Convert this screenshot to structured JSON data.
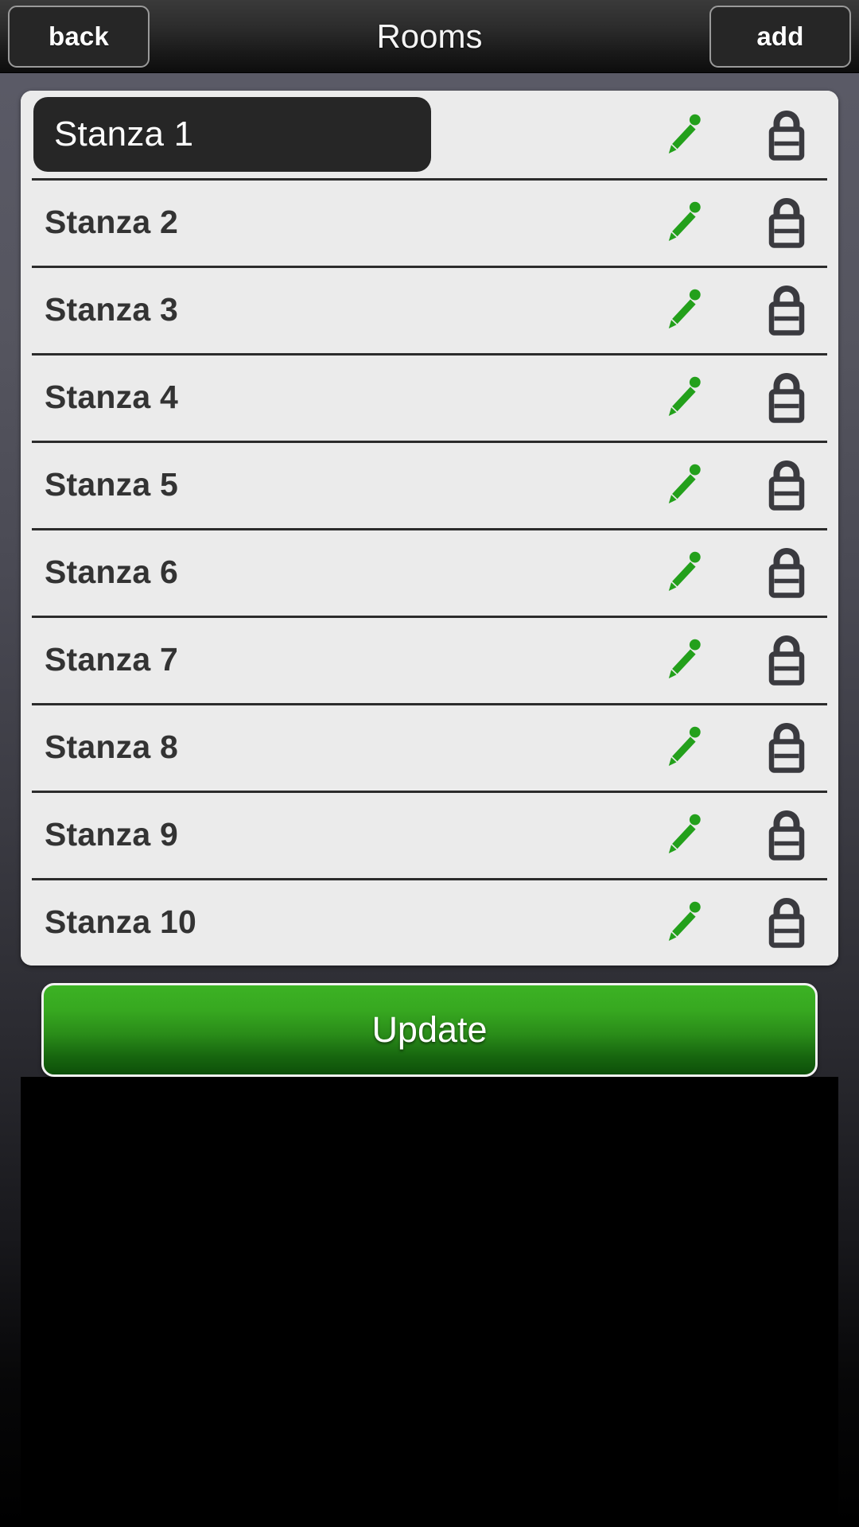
{
  "header": {
    "back_label": "back",
    "title": "Rooms",
    "add_label": "add"
  },
  "list": {
    "rows": [
      {
        "label": "Stanza 1",
        "editing": true,
        "edit_icon": "pencil-icon",
        "lock_icon": "lock-icon"
      },
      {
        "label": "Stanza 2",
        "editing": false,
        "edit_icon": "pencil-icon",
        "lock_icon": "lock-icon"
      },
      {
        "label": "Stanza 3",
        "editing": false,
        "edit_icon": "pencil-icon",
        "lock_icon": "lock-icon"
      },
      {
        "label": "Stanza 4",
        "editing": false,
        "edit_icon": "pencil-icon",
        "lock_icon": "lock-icon"
      },
      {
        "label": "Stanza 5",
        "editing": false,
        "edit_icon": "pencil-icon",
        "lock_icon": "lock-icon"
      },
      {
        "label": "Stanza 6",
        "editing": false,
        "edit_icon": "pencil-icon",
        "lock_icon": "lock-icon"
      },
      {
        "label": "Stanza 7",
        "editing": false,
        "edit_icon": "pencil-icon",
        "lock_icon": "lock-icon"
      },
      {
        "label": "Stanza 8",
        "editing": false,
        "edit_icon": "pencil-icon",
        "lock_icon": "lock-icon"
      },
      {
        "label": "Stanza 9",
        "editing": false,
        "edit_icon": "pencil-icon",
        "lock_icon": "lock-icon"
      },
      {
        "label": "Stanza 10",
        "editing": false,
        "edit_icon": "pencil-icon",
        "lock_icon": "lock-icon"
      }
    ]
  },
  "footer": {
    "update_label": "Update"
  },
  "colors": {
    "accent_green": "#23a01b",
    "button_green_top": "#3cb224",
    "button_green_bottom": "#0d4f09",
    "list_background": "#ebebeb",
    "row_text": "#333333",
    "separator": "#2b2b2b",
    "editing_background": "#262626",
    "editing_text": "#ffffff",
    "page_background_top": "#5a5a66",
    "page_background_bottom": "#000000",
    "header_button_fill": "#262626",
    "header_button_border": "#9a9a9a",
    "lock_icon": "#3a3a3f"
  }
}
